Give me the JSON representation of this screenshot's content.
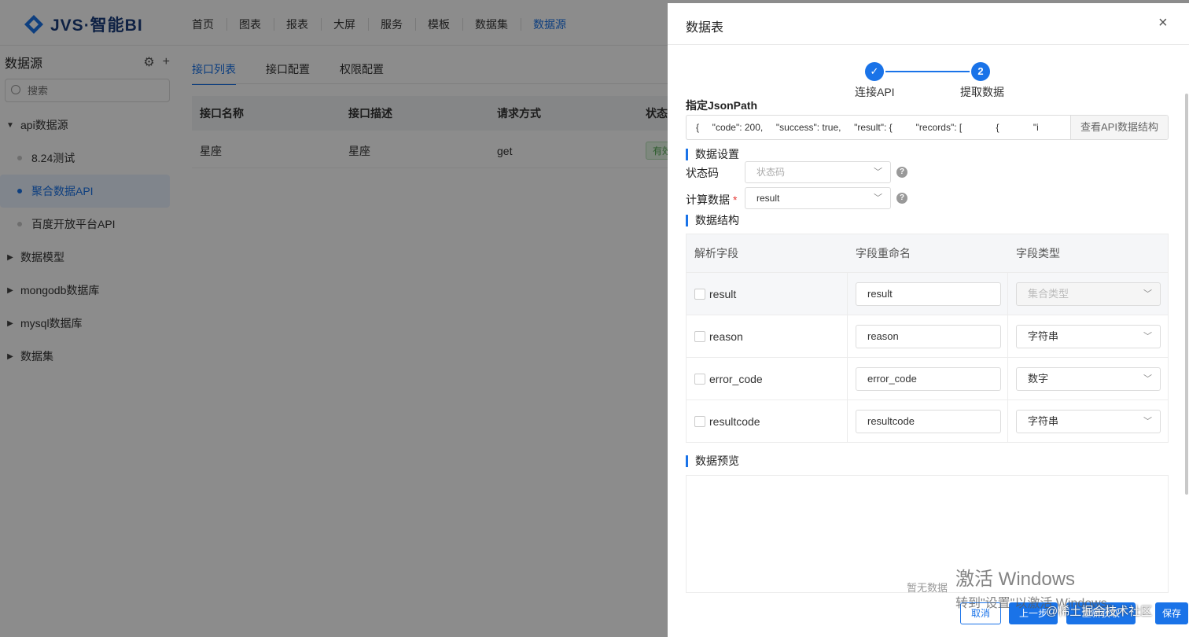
{
  "app": {
    "logo_text": "JVS·智能BI",
    "nav": [
      "首页",
      "图表",
      "报表",
      "大屏",
      "服务",
      "模板",
      "数据集",
      "数据源"
    ],
    "nav_active_index": 7
  },
  "sidebar": {
    "title": "数据源",
    "search_placeholder": "搜索",
    "tree": [
      {
        "label": "api数据源",
        "expanded": true,
        "children": [
          {
            "label": "8.24测试",
            "active": false
          },
          {
            "label": "聚合数据API",
            "active": true
          },
          {
            "label": "百度开放平台API",
            "active": false
          }
        ]
      },
      {
        "label": "数据模型",
        "expanded": false
      },
      {
        "label": "mongodb数据库",
        "expanded": false
      },
      {
        "label": "mysql数据库",
        "expanded": false
      },
      {
        "label": "数据集",
        "expanded": false
      }
    ]
  },
  "main": {
    "tabs": [
      "接口列表",
      "接口配置",
      "权限配置"
    ],
    "active_tab_index": 0,
    "columns": [
      "接口名称",
      "接口描述",
      "请求方式",
      "状态"
    ],
    "rows": [
      {
        "name": "星座",
        "desc": "星座",
        "method": "get",
        "status": "有效"
      }
    ]
  },
  "drawer": {
    "title": "数据表",
    "close_icon": "×",
    "steps": [
      {
        "label": "连接API",
        "mark": "✓",
        "done": true
      },
      {
        "label": "提取数据",
        "mark": "2",
        "current": true
      }
    ],
    "jsonpath_label": "指定JsonPath",
    "jsonpath_value": "{     \"code\": 200,     \"success\": true,     \"result\": {         \"records\": [             {             \"i",
    "view_structure_button": "查看API数据结构",
    "data_settings_title": "数据设置",
    "status_code_label": "状态码",
    "status_code_placeholder": "状态码",
    "calc_data_label": "计算数据",
    "calc_data_value": "result",
    "help_icon": "?",
    "data_structure_title": "数据结构",
    "table_headers": [
      "解析字段",
      "字段重命名",
      "字段类型"
    ],
    "fields": [
      {
        "field": "result",
        "rename": "result",
        "type": "集合类型",
        "disabled": true
      },
      {
        "field": "reason",
        "rename": "reason",
        "type": "字符串",
        "disabled": false
      },
      {
        "field": "error_code",
        "rename": "error_code",
        "type": "数字",
        "disabled": false
      },
      {
        "field": "resultcode",
        "rename": "resultcode",
        "type": "字符串",
        "disabled": false
      }
    ],
    "preview_title": "数据预览",
    "preview_empty": "暂无数据",
    "buttons": {
      "cancel": "取消",
      "prev": "上一步",
      "refetch": "重新获取",
      "save": "保存"
    }
  },
  "overlay": {
    "activate_title": "激活 Windows",
    "activate_sub": "转到\"设置\"以激活 Windows。",
    "community": "@稀土掘金技术社区"
  },
  "colors": {
    "primary": "#1a73e8",
    "mask": "rgba(0,0,0,0.45)"
  }
}
